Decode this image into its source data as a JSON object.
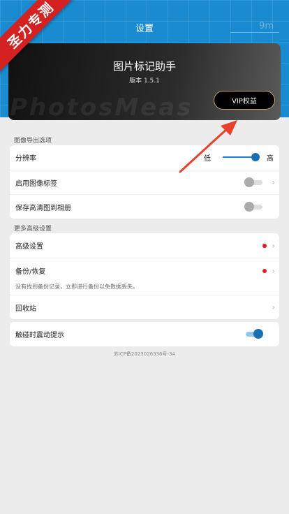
{
  "ribbon": {
    "text": "圣力专测"
  },
  "header": {
    "title": "设置",
    "scale_text": "9m"
  },
  "hero": {
    "app_name": "图片标记助手",
    "version": "版本 1.5.1",
    "watermark": "PhotosMeas",
    "vip_label": "VIP权益"
  },
  "sections": {
    "export": {
      "title": "图像导出选项",
      "resolution_label": "分辨率",
      "resolution_low": "低",
      "resolution_high": "高",
      "enable_tag_label": "启用图像标签",
      "enable_tag_on": false,
      "save_hd_label": "保存高清图到相册",
      "save_hd_on": false
    },
    "advanced": {
      "title": "更多高级设置",
      "advanced_label": "高级设置",
      "backup_label": "备份/恢复",
      "backup_note": "没有找到备份记录，立即进行备份以免数据丢失。",
      "recycle_label": "回收站"
    },
    "haptics": {
      "label": "触碰时震动提示",
      "on": true
    }
  },
  "footer": {
    "icp": "苏ICP备2023026336号-3A"
  },
  "colors": {
    "accent": "#1a6fb3",
    "alert": "#e21b1b",
    "ribbon": "#d42121"
  }
}
